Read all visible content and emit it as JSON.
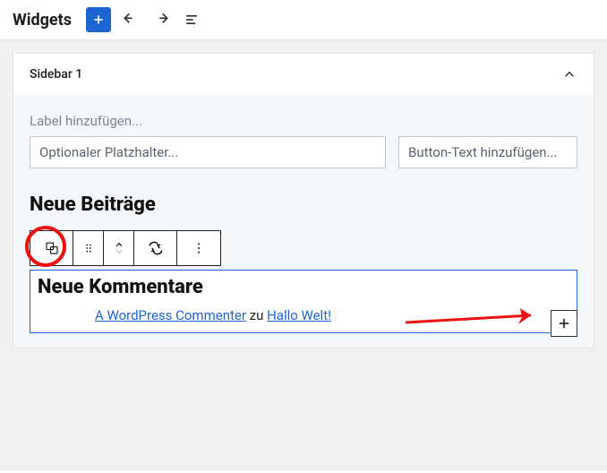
{
  "topbar": {
    "title": "Widgets"
  },
  "panel": {
    "title": "Sidebar 1"
  },
  "form": {
    "label_prompt": "Label hinzufügen...",
    "placeholder_input": "Optionaler Platzhalter...",
    "button_text_prompt": "Button-Text hinzufügen..."
  },
  "sections": {
    "recent_posts_heading": "Neue Beiträge",
    "recent_comments_heading": "Neue Kommentare"
  },
  "comment": {
    "author": "A WordPress Commenter",
    "on": " zu ",
    "post": "Hallo Welt!"
  }
}
